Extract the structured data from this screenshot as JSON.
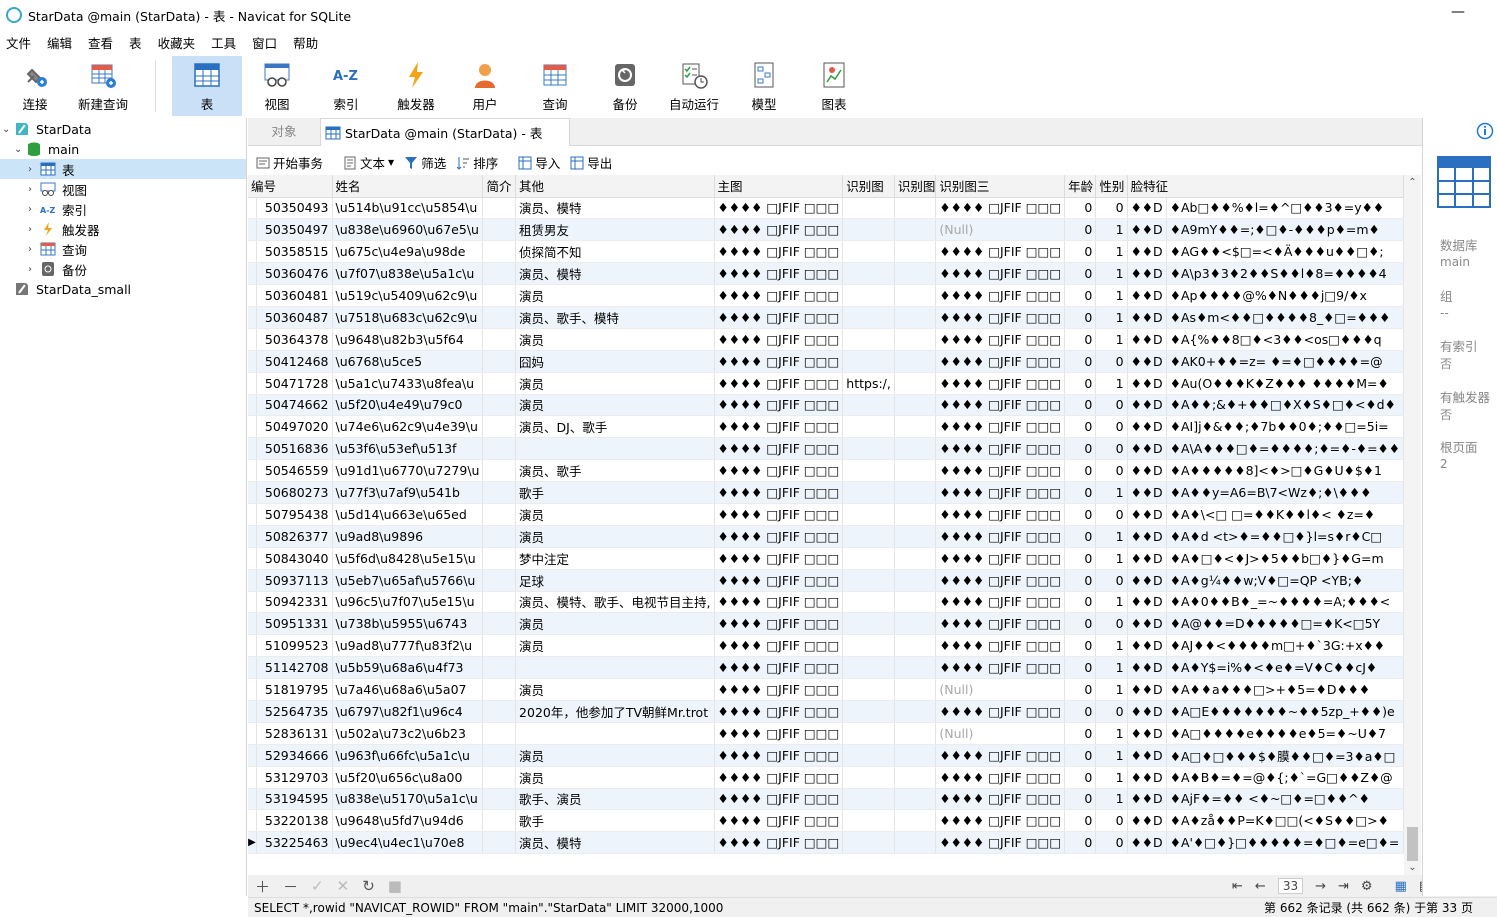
{
  "window": {
    "title": "StarData @main (StarData) - 表 - Navicat for SQLite",
    "minimize": "—"
  },
  "menu": [
    "文件",
    "编辑",
    "查看",
    "表",
    "收藏夹",
    "工具",
    "窗口",
    "帮助"
  ],
  "toolbar": [
    "连接",
    "新建查询",
    "表",
    "视图",
    "索引",
    "触发器",
    "用户",
    "查询",
    "备份",
    "自动运行",
    "模型",
    "图表"
  ],
  "tree": {
    "db1": "StarData",
    "schema": "main",
    "items": [
      "表",
      "视图",
      "索引",
      "触发器",
      "查询",
      "备份"
    ],
    "db2": "StarData_small"
  },
  "tabs": {
    "objects": "对象",
    "active": "StarData @main (StarData) - 表"
  },
  "subtoolbar": {
    "begin_tx": "开始事务",
    "text": "文本",
    "filter": "筛选",
    "sort": "排序",
    "import": "导入",
    "export": "导出"
  },
  "table": {
    "columns": [
      "编号",
      "姓名",
      "简介",
      "其他",
      "主图",
      "识别图",
      "识别图",
      "识别图三",
      "年龄",
      "性别",
      "脸特征"
    ],
    "rows": [
      [
        "50350493",
        "\\u514b\\u91cc\\u5854\\u",
        "",
        "演员、模特",
        "♦♦♦♦ □JFIF □□□",
        "",
        "",
        "♦♦♦♦ □JFIF □□□",
        "0",
        "0",
        "♦♦D",
        "♦Ab□♦♦%♦l=♦^□♦♦3♦=y♦♦"
      ],
      [
        "50350497",
        "\\u838e\\u6960\\u67e5\\u",
        "",
        "租赁男友",
        "♦♦♦♦ □JFIF □□□",
        "",
        "",
        "(Null)",
        "0",
        "1",
        "♦♦D",
        "♦A9mY♦♦=;♦□♦-♦♦♦p♦=m♦"
      ],
      [
        "50358515",
        "\\u675c\\u4e9a\\u98de",
        "",
        "侦探简不知",
        "♦♦♦♦ □JFIF □□□",
        "",
        "",
        "♦♦♦♦ □JFIF □□□",
        "0",
        "1",
        "♦♦D",
        "♦AG♦♦<$□=<♦Ä♦♦♦u♦♦□♦;"
      ],
      [
        "50360476",
        "\\u7f07\\u838e\\u5a1c\\u",
        "",
        "演员、模特",
        "♦♦♦♦ □JFIF □□□",
        "",
        "",
        "♦♦♦♦ □JFIF □□□",
        "0",
        "1",
        "♦♦D",
        "♦A\\p3♦3♦2♦♦S♦♦l♦8=♦♦♦♦4"
      ],
      [
        "50360481",
        "\\u519c\\u5409\\u62c9\\u",
        "",
        "演员",
        "♦♦♦♦ □JFIF □□□",
        "",
        "",
        "♦♦♦♦ □JFIF □□□",
        "0",
        "1",
        "♦♦D",
        "♦Ap♦♦♦♦@%♦N♦♦♦j□9/♦x"
      ],
      [
        "50360487",
        "\\u7518\\u683c\\u62c9\\u",
        "",
        "演员、歌手、模特",
        "♦♦♦♦ □JFIF □□□",
        "",
        "",
        "♦♦♦♦ □JFIF □□□",
        "0",
        "1",
        "♦♦D",
        "♦As♦m<♦♦□♦♦♦♦8_♦□=♦♦♦"
      ],
      [
        "50364378",
        "\\u9648\\u82b3\\u5f64",
        "",
        "演员",
        "♦♦♦♦ □JFIF □□□",
        "",
        "",
        "♦♦♦♦ □JFIF □□□",
        "0",
        "1",
        "♦♦D",
        "♦A{%♦♦8□♦<3♦♦<os□♦♦♦q"
      ],
      [
        "50412468",
        "\\u6768\\u5ce5",
        "",
        "囧妈",
        "♦♦♦♦ □JFIF □□□",
        "",
        "",
        "♦♦♦♦ □JFIF □□□",
        "0",
        "0",
        "♦♦D",
        "♦AK0+♦♦=z= ♦=♦□♦♦♦♦=@"
      ],
      [
        "50471728",
        "\\u5a1c\\u7433\\u8fea\\u",
        "",
        "演员",
        "♦♦♦♦ □JFIF □□□",
        "https:/,",
        "",
        "♦♦♦♦ □JFIF □□□",
        "0",
        "1",
        "♦♦D",
        "♦Au(O♦♦♦K♦Z♦♦♦ ♦♦♦♦M=♦"
      ],
      [
        "50474662",
        "\\u5f20\\u4e49\\u79c0",
        "",
        "演员",
        "♦♦♦♦ □JFIF □□□",
        "",
        "",
        "♦♦♦♦ □JFIF □□□",
        "0",
        "0",
        "♦♦D",
        "♦A♦♦;&♦+♦♦□♦X♦S♦□♦<♦d♦"
      ],
      [
        "50497020",
        "\\u74e6\\u62c9\\u4e39\\u",
        "",
        "演员、DJ、歌手",
        "♦♦♦♦ □JFIF □□□",
        "",
        "",
        "♦♦♦♦ □JFIF □□□",
        "0",
        "0",
        "♦♦D",
        "♦AI]j♦&♦♦;♦7b♦♦0♦;♦♦□=5i="
      ],
      [
        "50516836",
        "\\u53f6\\u53ef\\u513f",
        "",
        "",
        "♦♦♦♦ □JFIF □□□",
        "",
        "",
        "♦♦♦♦ □JFIF □□□",
        "0",
        "0",
        "♦♦D",
        "♦A\\A♦♦♦□♦=♦♦♦♦;♦=♦-♦=♦♦"
      ],
      [
        "50546559",
        "\\u91d1\\u6770\\u7279\\u",
        "",
        "演员、歌手",
        "♦♦♦♦ □JFIF □□□",
        "",
        "",
        "♦♦♦♦ □JFIF □□□",
        "0",
        "0",
        "♦♦D",
        "♦A♦♦♦♦♦8]<♦>□♦G♦U♦$♦1"
      ],
      [
        "50680273",
        "\\u77f3\\u7af9\\u541b",
        "",
        "歌手",
        "♦♦♦♦ □JFIF □□□",
        "",
        "",
        "♦♦♦♦ □JFIF □□□",
        "0",
        "1",
        "♦♦D",
        "♦A♦♦y=A6=B\\7<Wz♦;♦\\♦♦♦"
      ],
      [
        "50795438",
        "\\u5d14\\u663e\\u65ed",
        "",
        "演员",
        "♦♦♦♦ □JFIF □□□",
        "",
        "",
        "♦♦♦♦ □JFIF □□□",
        "0",
        "0",
        "♦♦D",
        "♦A♦\\<□ □=♦♦K♦♦l♦< ♦z=♦"
      ],
      [
        "50826377",
        "\\u9ad8\\u9896",
        "",
        "演员",
        "♦♦♦♦ □JFIF □□□",
        "",
        "",
        "♦♦♦♦ □JFIF □□□",
        "0",
        "1",
        "♦♦D",
        "♦A♦d <t>♦=♦♦□♦}l=s♦r♦C□"
      ],
      [
        "50843040",
        "\\u5f6d\\u8428\\u5e15\\u",
        "",
        "梦中注定",
        "♦♦♦♦ □JFIF □□□",
        "",
        "",
        "♦♦♦♦ □JFIF □□□",
        "0",
        "1",
        "♦♦D",
        "♦A♦□♦<♦J>♦5♦♦b□♦}♦G=m"
      ],
      [
        "50937113",
        "\\u5eb7\\u65af\\u5766\\u",
        "",
        "足球",
        "♦♦♦♦ □JFIF □□□",
        "",
        "",
        "♦♦♦♦ □JFIF □□□",
        "0",
        "0",
        "♦♦D",
        "♦A♦g¼♦♦w;V♦□=QP <YB;♦"
      ],
      [
        "50942331",
        "\\u96c5\\u7f07\\u5e15\\u",
        "",
        "演员、模特、歌手、电视节目主持,",
        "♦♦♦♦ □JFIF □□□",
        "",
        "",
        "♦♦♦♦ □JFIF □□□",
        "0",
        "1",
        "♦♦D",
        "♦A♦0♦♦B♦_=~♦♦♦♦=A;♦♦♦<"
      ],
      [
        "50951331",
        "\\u738b\\u5955\\u6743",
        "",
        "演员",
        "♦♦♦♦ □JFIF □□□",
        "",
        "",
        "♦♦♦♦ □JFIF □□□",
        "0",
        "0",
        "♦♦D",
        "♦A@♦♦=D♦♦♦♦♦□=♦K<□5Y"
      ],
      [
        "51099523",
        "\\u9ad8\\u777f\\u83f2\\u",
        "",
        "演员",
        "♦♦♦♦ □JFIF □□□",
        "",
        "",
        "♦♦♦♦ □JFIF □□□",
        "0",
        "1",
        "♦♦D",
        "♦AJ♦♦<♦♦♦♦m□+♦`3G:+x♦♦"
      ],
      [
        "51142708",
        "\\u5b59\\u68a6\\u4f73",
        "",
        "",
        "♦♦♦♦ □JFIF □□□",
        "",
        "",
        "♦♦♦♦ □JFIF □□□",
        "0",
        "1",
        "♦♦D",
        "♦A♦Y$=i%♦<♦e♦=V♦C♦♦cJ♦"
      ],
      [
        "51819795",
        "\\u7a46\\u68a6\\u5a07",
        "",
        "演员",
        "♦♦♦♦ □JFIF □□□",
        "",
        "",
        "(Null)",
        "0",
        "1",
        "♦♦D",
        "♦A♦♦a♦♦♦□>+♦5=♦D♦♦♦"
      ],
      [
        "52564735",
        "\\u6797\\u82f1\\u96c4",
        "",
        "2020年，他参加了TV朝鲜Mr.trot",
        "♦♦♦♦ □JFIF □□□",
        "",
        "",
        "♦♦♦♦ □JFIF □□□",
        "0",
        "0",
        "♦♦D",
        "♦A□E♦♦♦♦♦♦♦~♦♦5zp_+♦♦)e"
      ],
      [
        "52836131",
        "\\u502a\\u73c2\\u6b23",
        "",
        "",
        "♦♦♦♦ □JFIF □□□",
        "",
        "",
        "(Null)",
        "0",
        "1",
        "♦♦D",
        "♦A□♦♦♦♦e♦♦♦♦e♦5=♦~U♦7"
      ],
      [
        "52934666",
        "\\u963f\\u66fc\\u5a1c\\u",
        "",
        "演员",
        "♦♦♦♦ □JFIF □□□",
        "",
        "",
        "♦♦♦♦ □JFIF □□□",
        "0",
        "1",
        "♦♦D",
        "♦A□♦□♦♦♦$♦膜♦♦□♦=3♦a♦□"
      ],
      [
        "53129703",
        "\\u5f20\\u656c\\u8a00",
        "",
        "演员",
        "♦♦♦♦ □JFIF □□□",
        "",
        "",
        "♦♦♦♦ □JFIF □□□",
        "0",
        "1",
        "♦♦D",
        "♦A♦B♦=♦=@♦{;♦`=G□♦♦Z♦@"
      ],
      [
        "53194595",
        "\\u838e\\u5170\\u5a1c\\u",
        "",
        "歌手、演员",
        "♦♦♦♦ □JFIF □□□",
        "",
        "",
        "♦♦♦♦ □JFIF □□□",
        "0",
        "1",
        "♦♦D",
        "♦AjF♦=♦♦ <♦~□♦=□♦♦^♦"
      ],
      [
        "53220138",
        "\\u9648\\u5fd7\\u94d6",
        "",
        "歌手",
        "♦♦♦♦ □JFIF □□□",
        "",
        "",
        "♦♦♦♦ □JFIF □□□",
        "0",
        "0",
        "♦♦D",
        "♦A♦zå♦♦P=K♦□□(<♦S♦♦□>♦"
      ],
      [
        "53225463",
        "\\u9ec4\\u4ec1\\u70e8",
        "",
        "演员、模特",
        "♦♦♦♦ □JFIF □□□",
        "",
        "",
        "♦♦♦♦ □JFIF □□□",
        "0",
        "0",
        "♦♦D",
        "♦A'♦□♦}□♦♦♦♦♦=♦□♦=e□♦="
      ]
    ]
  },
  "pager": {
    "page": "33"
  },
  "status": {
    "sql": "SELECT *,rowid \"NAVICAT_ROWID\" FROM \"main\".\"StarData\" LIMIT 32000,1000",
    "records": "第 662 条记录 (共 662 条) 于第 33 页"
  },
  "info_panel": {
    "labels": [
      "数据库",
      "组",
      "有索引",
      "有触发器",
      "根页面"
    ],
    "values": [
      "main",
      "--",
      "否",
      "否",
      "2"
    ]
  },
  "colors": {
    "accent": "#1e7cd8",
    "selected": "#cce4f7",
    "toolbar_active": "#c9e0f7",
    "alt_row": "#eef4fc"
  }
}
